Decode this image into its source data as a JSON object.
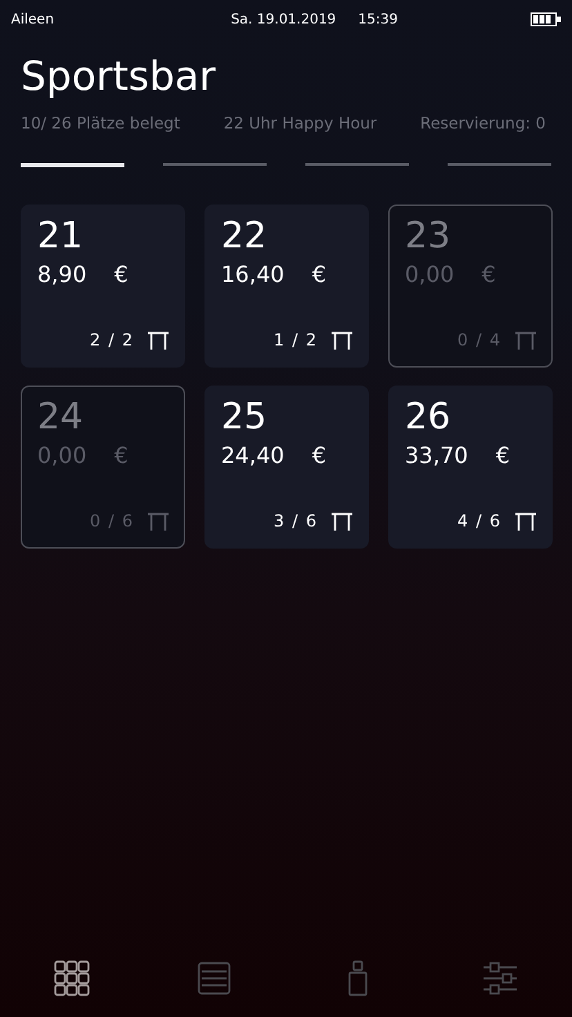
{
  "status_bar": {
    "user": "Aileen",
    "date": "Sa. 19.01.2019",
    "time": "15:39"
  },
  "title": "Sportsbar",
  "info": [
    "10/ 26 Plätze belegt",
    "22 Uhr Happy Hour",
    "Reservierung: 0"
  ],
  "pages": [
    {
      "selected": true
    },
    {
      "selected": false
    },
    {
      "selected": false
    },
    {
      "selected": false
    }
  ],
  "tables": [
    {
      "number": "21",
      "amount": "8,90",
      "currency": "€",
      "seats": "2 / 2",
      "occupied": true
    },
    {
      "number": "22",
      "amount": "16,40",
      "currency": "€",
      "seats": "1 / 2",
      "occupied": true
    },
    {
      "number": "23",
      "amount": "0,00",
      "currency": "€",
      "seats": "0 / 4",
      "occupied": false
    },
    {
      "number": "24",
      "amount": "0,00",
      "currency": "€",
      "seats": "0 / 6",
      "occupied": false
    },
    {
      "number": "25",
      "amount": "24,40",
      "currency": "€",
      "seats": "3 / 6",
      "occupied": true
    },
    {
      "number": "26",
      "amount": "33,70",
      "currency": "€",
      "seats": "4 / 6",
      "occupied": true
    }
  ],
  "nav": [
    {
      "kind": "grid",
      "selected": true
    },
    {
      "kind": "list",
      "selected": false
    },
    {
      "kind": "bottle",
      "selected": false
    },
    {
      "kind": "sliders",
      "selected": false
    }
  ]
}
